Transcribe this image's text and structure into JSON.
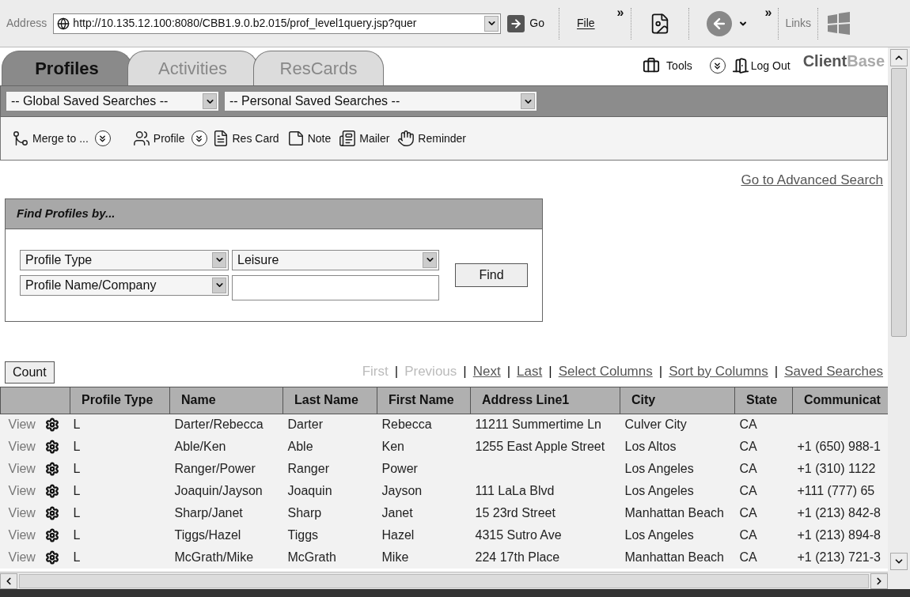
{
  "browser_toolbar": {
    "address_label": "Address",
    "url": "http://10.135.12.100:8080/CBB1.9.0.b2.015/prof_level1query.jsp?quer",
    "go": "Go",
    "file_menu": "File",
    "overflow_1": "»",
    "overflow_2": "»",
    "links": "Links"
  },
  "tabs": [
    {
      "label": "Profiles",
      "selected": true
    },
    {
      "label": "Activities",
      "selected": false
    },
    {
      "label": "ResCards",
      "selected": false
    }
  ],
  "header": {
    "tools": "Tools",
    "logout": "Log Out",
    "brand_dark": "Client",
    "brand_light": "Base"
  },
  "saved_searches": {
    "global": "-- Global Saved Searches --",
    "personal": "-- Personal Saved Searches --"
  },
  "actions": [
    {
      "label": "Merge to ...",
      "kind": "merge",
      "has_menu": true
    },
    {
      "label": "Profile",
      "kind": "profile",
      "has_menu": true
    },
    {
      "label": "Res Card",
      "kind": "rescard",
      "has_menu": false
    },
    {
      "label": "Note",
      "kind": "note",
      "has_menu": false
    },
    {
      "label": "Mailer",
      "kind": "mailer",
      "has_menu": false
    },
    {
      "label": "Reminder",
      "kind": "reminder",
      "has_menu": false
    }
  ],
  "advanced_search_link": "Go to Advanced Search",
  "find_panel": {
    "title": "Find Profiles by...",
    "rows": [
      {
        "field": "Profile Type",
        "kind": "select",
        "value": "Leisure"
      },
      {
        "field": "Profile Name/Company",
        "kind": "input"
      }
    ],
    "find_button": "Find"
  },
  "count_button": "Count",
  "pagination": [
    {
      "kind": "link",
      "label": "First",
      "disabled": true
    },
    {
      "kind": "separator",
      "label": "|"
    },
    {
      "kind": "link",
      "label": "Previous",
      "disabled": true
    },
    {
      "kind": "separator",
      "label": "|"
    },
    {
      "kind": "link",
      "label": "Next",
      "disabled": false
    },
    {
      "kind": "separator",
      "label": "|"
    },
    {
      "kind": "link",
      "label": "Last",
      "disabled": false
    },
    {
      "kind": "separator",
      "label": "|"
    },
    {
      "kind": "link",
      "label": "Select Columns",
      "disabled": false
    },
    {
      "kind": "separator",
      "label": "|"
    },
    {
      "kind": "link",
      "label": "Sort by Columns",
      "disabled": false
    },
    {
      "kind": "separator",
      "label": "|"
    },
    {
      "kind": "link",
      "label": "Saved Searches",
      "disabled": false
    }
  ],
  "table": {
    "columns": [
      "",
      "Profile Type",
      "Name",
      "Last Name",
      "First Name",
      "Address Line1",
      "City",
      "State",
      "Communicat"
    ],
    "rows": [
      {
        "cells": [
          "View",
          "L",
          "Darter/Rebecca",
          "Darter",
          "Rebecca",
          "11211 Summertime Ln",
          "Culver City",
          "CA",
          ""
        ]
      },
      {
        "cells": [
          "View",
          "L",
          "Able/Ken",
          "Able",
          "Ken",
          "1255 East Apple Street",
          "Los Altos",
          "CA",
          "+1 (650) 988-1"
        ]
      },
      {
        "cells": [
          "View",
          "L",
          "Ranger/Power",
          "Ranger",
          "Power",
          "",
          "Los Angeles",
          "CA",
          "+1 (310) 1122"
        ]
      },
      {
        "cells": [
          "View",
          "L",
          "Joaquin/Jayson",
          "Joaquin",
          "Jayson",
          "111 LaLa Blvd",
          "Los Angeles",
          "CA",
          "+111 (777) 65"
        ]
      },
      {
        "cells": [
          "View",
          "L",
          "Sharp/Janet",
          "Sharp",
          "Janet",
          "15 23rd Street",
          "Manhattan Beach",
          "CA",
          "+1 (213) 842-8"
        ]
      },
      {
        "cells": [
          "View",
          "L",
          "Tiggs/Hazel",
          "Tiggs",
          "Hazel",
          "4315 Sutro Ave",
          "Los Angeles",
          "CA",
          "+1 (213) 894-8"
        ]
      },
      {
        "cells": [
          "View",
          "L",
          "McGrath/Mike",
          "McGrath",
          "Mike",
          "224 17th Place",
          "Manhattan Beach",
          "CA",
          "+1 (213) 721-3"
        ]
      }
    ]
  }
}
